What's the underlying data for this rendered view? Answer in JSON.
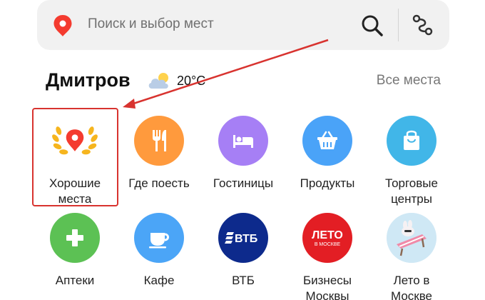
{
  "search": {
    "placeholder": "Поиск и выбор мест",
    "pin_color": "#f43b2f",
    "search_icon": "magnifier-icon",
    "route_icon": "route-icon"
  },
  "header": {
    "city": "Дмитров",
    "weather_icon": "cloud-icon",
    "temperature": "20°C",
    "all_places": "Все места"
  },
  "annotation": {
    "color": "#d8332f"
  },
  "categories": [
    {
      "label": "Хорошие\nместа",
      "icon": "good-places-laurel-icon",
      "color": "#ffffff",
      "highlighted": true
    },
    {
      "label": "Где поесть",
      "icon": "fork-knife-icon",
      "color": "#ff9a3d"
    },
    {
      "label": "Гостиницы",
      "icon": "bed-icon",
      "color": "#a67ff5"
    },
    {
      "label": "Продукты",
      "icon": "basket-icon",
      "color": "#4aa3f8"
    },
    {
      "label": "Торговые\nцентры",
      "icon": "shopping-bag-icon",
      "color": "#41b6e8"
    },
    {
      "label": "Аптеки",
      "icon": "pharmacy-cross-icon",
      "color": "#5cc154"
    },
    {
      "label": "Кафе",
      "icon": "coffee-cup-icon",
      "color": "#4ba5f7"
    },
    {
      "label": "ВТБ",
      "icon": "vtb-logo-icon",
      "color": "#0d2a8c",
      "logo_text": "ВТБ"
    },
    {
      "label": "Бизнесы\nМосквы",
      "icon": "leto-v-moskve-logo-icon",
      "color": "#e31e24",
      "logo_text": "ЛЕТО",
      "logo_subtext": "В МОСКВЕ"
    },
    {
      "label": "Лето в\nМоскве",
      "icon": "summer-deckchair-icon",
      "color": "#d9ecf6"
    }
  ]
}
